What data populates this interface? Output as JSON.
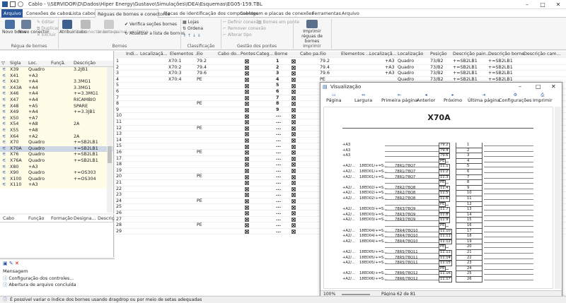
{
  "window": {
    "title": "Cablo - \\\\SERVIDOR\\D\\Dados\\Hiper Energy\\Gustavo\\Simulações\\IDEA\\Esquemas\\EG05-159.TBL"
  },
  "tabs": [
    "Arquivo",
    "Conexões de cabos",
    "Lista cabos",
    "Réguas de bornes e conectores",
    "Placas de identificação dos componentes",
    "Cablagem e placas de conexões",
    "Ferramentas",
    "Arquivo"
  ],
  "ribbon": {
    "novo_borne": "Novo borne",
    "novo_conector": "Novo conector",
    "editar": "Editar",
    "duplicar": "Duplicar",
    "excluir": "Excluir",
    "atribuir_cabo": "Atribuir cabo",
    "desconectar_bornes": "Desconectar bornes",
    "inverte_painel": "Inverte painel ↔externo",
    "verifica": "Verifica seções bornes",
    "atualizar": "Atualizar a lista de bornes",
    "lojas": "Lojas",
    "ordena": "Ordena",
    "definir": "Definir conexão",
    "remover": "Remover conexão",
    "alterar": "Alterar tipo",
    "bornes_ponte": "Bornes em ponte",
    "imprimir": "Imprimir réguas de bornes",
    "grp_reguas": "Régua de bornes",
    "grp_bornes": "Bornes",
    "grp_class": "Classificação",
    "grp_pontes": "Gestão dos pontes",
    "grp_imprimir": "Imprimir"
  },
  "left": {
    "headers": [
      "Sigla",
      "Loc.",
      "Funçã.",
      "Descrição"
    ],
    "rows": [
      [
        "X39",
        "Quadro",
        "",
        "3.2JB1"
      ],
      [
        "X41",
        "+A3",
        "",
        ""
      ],
      [
        "X43",
        "+A4",
        "",
        "3.3MG1"
      ],
      [
        "X43A",
        "+A4",
        "",
        "3.3MG1"
      ],
      [
        "X46",
        "+A4",
        "",
        "+=3.3MG1"
      ],
      [
        "X47",
        "+A4",
        "",
        "RICAMBIO"
      ],
      [
        "X48",
        "+A5",
        "",
        "SPARE"
      ],
      [
        "X49",
        "+A4",
        "",
        "+=3.3JB1"
      ],
      [
        "X50",
        "+A7",
        "",
        ""
      ],
      [
        "X54",
        "+A8",
        "",
        "2A"
      ],
      [
        "X55",
        "+A8",
        "",
        ""
      ],
      [
        "X64",
        "+A2",
        "",
        "2A"
      ],
      [
        "X70",
        "Quadro",
        "",
        "+=SB2LB1"
      ],
      [
        "X70A",
        "Quadro",
        "",
        "+=SB2LB1"
      ],
      [
        "X76",
        "Quadro",
        "",
        "+=SB2LB1"
      ],
      [
        "X76A",
        "Quadro",
        "",
        "+=SB2LB1"
      ],
      [
        "X80",
        "+A3",
        "",
        ""
      ],
      [
        "X90",
        "Quadro",
        "",
        "+=OS303"
      ],
      [
        "X100",
        "Quadro",
        "",
        "+=OS304"
      ],
      [
        "X110",
        "+A3",
        "",
        ""
      ]
    ],
    "bottom_headers": [
      "Cabo",
      "Função",
      "Formação",
      "Designa...",
      "Descrição"
    ]
  },
  "messages": {
    "header": "Mensagem",
    "items": [
      "Configuração dos controles...",
      "Abertura de arquivo concluída"
    ]
  },
  "status": "É possível variar o índice dos bornes usando dragdrop ou por meio de setas adequadas",
  "grid": {
    "headers": [
      "Indi...",
      "Localizaçã...",
      "Elementos ...",
      "Fio",
      "Cabo do...",
      "Pontes",
      "Categ...",
      "Borne",
      "Cabo pa...",
      "Fio",
      "Elementos ...",
      "Localizaçã...",
      "Localização",
      "Posição",
      "Descrição pain...",
      "Descrição borne",
      "Descrição cam..."
    ],
    "rows": [
      {
        "i": "1",
        "el": "X70:1",
        "fio": "79.2",
        "b": "1",
        "fio2": "79.2",
        "loc": "+A3",
        "loc2": "Quadro",
        "pos": "73/B2",
        "d1": "+=SB2LB1",
        "d2": "+=SB2LB1"
      },
      {
        "i": "2",
        "el": "X70:2",
        "fio": "79.4",
        "b": "2",
        "fio2": "79.4",
        "loc": "+A3",
        "loc2": "Quadro",
        "pos": "73/B2",
        "d1": "+=SB2LB1",
        "d2": "+=SB2LB1"
      },
      {
        "i": "3",
        "el": "X70:3",
        "fio": "79.6",
        "b": "3",
        "fio2": "79.6",
        "loc": "+A3",
        "loc2": "Quadro",
        "pos": "73/B2",
        "d1": "+=SB2LB1",
        "d2": "+=SB2LB1"
      },
      {
        "i": "4",
        "el": "X70:4",
        "fio": "PE",
        "b": "4",
        "fio2": "PE",
        "loc": "",
        "loc2": "Quadro",
        "pos": "73/B2",
        "d1": "+=SB2LB1",
        "d2": "+=SB2LB1"
      },
      {
        "i": "5",
        "el": "",
        "fio": "",
        "b": "5",
        "fio2": "",
        "loc": "",
        "loc2": "",
        "pos": "",
        "d1": "",
        "d2": ""
      },
      {
        "i": "6",
        "el": "",
        "fio": "",
        "b": "6",
        "fio2": "",
        "loc": "",
        "loc2": "",
        "pos": "",
        "d1": "",
        "d2": ""
      },
      {
        "i": "7",
        "el": "",
        "fio": "",
        "b": "7",
        "fio2": "",
        "loc": "",
        "loc2": "",
        "pos": "",
        "d1": "",
        "d2": ""
      },
      {
        "i": "8",
        "el": "",
        "fio": "PE",
        "b": "8",
        "fio2": "",
        "loc": "",
        "loc2": "",
        "pos": "",
        "d1": "",
        "d2": ""
      },
      {
        "i": "9",
        "el": "",
        "fio": "",
        "b": "9",
        "fio2": "",
        "loc": "",
        "loc2": "",
        "pos": "",
        "d1": "",
        "d2": ""
      },
      {
        "i": "10",
        "el": "",
        "fio": "",
        "b": "...",
        "fio2": "",
        "loc": "",
        "loc2": "",
        "pos": "",
        "d1": "",
        "d2": ""
      },
      {
        "i": "11",
        "el": "",
        "fio": "",
        "b": "...",
        "fio2": "",
        "loc": "",
        "loc2": "",
        "pos": "",
        "d1": "",
        "d2": ""
      },
      {
        "i": "12",
        "el": "",
        "fio": "PE",
        "b": "...",
        "fio2": "",
        "loc": "",
        "loc2": "",
        "pos": "",
        "d1": "",
        "d2": ""
      },
      {
        "i": "13",
        "el": "",
        "fio": "",
        "b": "...",
        "fio2": "",
        "loc": "",
        "loc2": "",
        "pos": "",
        "d1": "",
        "d2": ""
      },
      {
        "i": "14",
        "el": "",
        "fio": "",
        "b": "...",
        "fio2": "",
        "loc": "",
        "loc2": "",
        "pos": "",
        "d1": "",
        "d2": ""
      },
      {
        "i": "15",
        "el": "",
        "fio": "",
        "b": "...",
        "fio2": "",
        "loc": "",
        "loc2": "",
        "pos": "",
        "d1": "",
        "d2": ""
      },
      {
        "i": "16",
        "el": "",
        "fio": "PE",
        "b": "...",
        "fio2": "",
        "loc": "",
        "loc2": "",
        "pos": "",
        "d1": "",
        "d2": ""
      },
      {
        "i": "17",
        "el": "",
        "fio": "",
        "b": "...",
        "fio2": "",
        "loc": "",
        "loc2": "",
        "pos": "",
        "d1": "",
        "d2": ""
      },
      {
        "i": "18",
        "el": "",
        "fio": "",
        "b": "...",
        "fio2": "",
        "loc": "",
        "loc2": "",
        "pos": "",
        "d1": "",
        "d2": ""
      },
      {
        "i": "19",
        "el": "",
        "fio": "",
        "b": "...",
        "fio2": "",
        "loc": "",
        "loc2": "",
        "pos": "",
        "d1": "",
        "d2": ""
      },
      {
        "i": "20",
        "el": "",
        "fio": "PE",
        "b": "...",
        "fio2": "",
        "loc": "",
        "loc2": "",
        "pos": "",
        "d1": "",
        "d2": ""
      },
      {
        "i": "21",
        "el": "",
        "fio": "",
        "b": "...",
        "fio2": "",
        "loc": "",
        "loc2": "",
        "pos": "",
        "d1": "",
        "d2": ""
      },
      {
        "i": "22",
        "el": "",
        "fio": "",
        "b": "...",
        "fio2": "",
        "loc": "",
        "loc2": "",
        "pos": "",
        "d1": "",
        "d2": ""
      },
      {
        "i": "23",
        "el": "",
        "fio": "",
        "b": "...",
        "fio2": "",
        "loc": "",
        "loc2": "",
        "pos": "",
        "d1": "",
        "d2": ""
      },
      {
        "i": "24",
        "el": "",
        "fio": "PE",
        "b": "...",
        "fio2": "",
        "loc": "",
        "loc2": "",
        "pos": "",
        "d1": "",
        "d2": ""
      },
      {
        "i": "25",
        "el": "",
        "fio": "",
        "b": "...",
        "fio2": "",
        "loc": "",
        "loc2": "",
        "pos": "",
        "d1": "",
        "d2": ""
      },
      {
        "i": "26",
        "el": "",
        "fio": "",
        "b": "...",
        "fio2": "",
        "loc": "",
        "loc2": "",
        "pos": "",
        "d1": "",
        "d2": ""
      },
      {
        "i": "27",
        "el": "",
        "fio": "",
        "b": "...",
        "fio2": "",
        "loc": "",
        "loc2": "",
        "pos": "",
        "d1": "",
        "d2": ""
      },
      {
        "i": "28",
        "el": "",
        "fio": "PE",
        "b": "...",
        "fio2": "",
        "loc": "",
        "loc2": "",
        "pos": "",
        "d1": "",
        "d2": ""
      },
      {
        "i": "29",
        "el": "",
        "fio": "",
        "b": "...",
        "fio2": "",
        "loc": "",
        "loc2": "",
        "pos": "",
        "d1": "",
        "d2": ""
      }
    ]
  },
  "preview": {
    "title": "Visualização",
    "buttons": [
      "Página",
      "Largura",
      "Primeira página",
      "Anterior",
      "Próximo",
      "Última página",
      "Configurações",
      "Imprimir"
    ],
    "sheet_title": "X70A",
    "rows": [
      {
        "a": "+A3",
        "m": "",
        "w": "79.2",
        "n": "1"
      },
      {
        "a": "+A3",
        "m": "",
        "w": "79.4",
        "n": "2"
      },
      {
        "a": "+A3",
        "m": "",
        "w": "79.6",
        "n": "3"
      },
      {
        "a": "",
        "m": "",
        "w": "PE",
        "n": "4"
      },
      {
        "a": "+A2/...",
        "m": "18ED01/+=S...",
        "c": "78R1/78Q7",
        "w": "11.1",
        "n": "5"
      },
      {
        "a": "+A2/...",
        "m": "18ED01/+=S...",
        "c": "78R1/78Q7",
        "w": "11.2",
        "n": "6"
      },
      {
        "a": "+A2/...",
        "m": "18ED01/+=S...",
        "c": "78R1/78Q7",
        "w": "11.3",
        "n": "7"
      },
      {
        "a": "",
        "m": "",
        "w": "PE",
        "n": "8"
      },
      {
        "a": "+A2/...",
        "m": "18ED02/+=S...",
        "c": "78R2/78Q8",
        "w": "11.4",
        "n": "9"
      },
      {
        "a": "+A2/...",
        "m": "18ED02/+=S...",
        "c": "78R2/78Q8",
        "w": "11.5",
        "n": "10"
      },
      {
        "a": "+A2/...",
        "m": "18ED02/+=S...",
        "c": "78R2/78Q8",
        "w": "11.6",
        "n": "11"
      },
      {
        "a": "",
        "m": "",
        "w": "PE",
        "n": "12"
      },
      {
        "a": "+A2/...",
        "m": "18ED03/+=S...",
        "c": "78R3/78Q9",
        "w": "11.7",
        "n": "13"
      },
      {
        "a": "+A2/...",
        "m": "18ED03/+=S...",
        "c": "78R3/78Q9",
        "w": "11.8",
        "n": "14"
      },
      {
        "a": "+A2/...",
        "m": "18ED03/+=S...",
        "c": "78R3/78Q9",
        "w": "11.9",
        "n": "15"
      },
      {
        "a": "",
        "m": "",
        "w": "PE",
        "n": "16"
      },
      {
        "a": "+A2/...",
        "m": "18ED04/+=S...",
        "c": "78R4/78Q10",
        "w": "11.10",
        "n": "17"
      },
      {
        "a": "+A2/...",
        "m": "18ED04/+=S...",
        "c": "78R4/78Q10",
        "w": "11.11",
        "n": "18"
      },
      {
        "a": "+A2/...",
        "m": "18ED04/+=S...",
        "c": "78R4/78Q10",
        "w": "11.12",
        "n": "19"
      },
      {
        "a": "",
        "m": "",
        "w": "PE",
        "n": "20"
      },
      {
        "a": "+A2/...",
        "m": "18ED05/+=S...",
        "c": "78R5/78Q11",
        "w": "11.13",
        "n": "21"
      },
      {
        "a": "+A2/...",
        "m": "18ED05/+=S...",
        "c": "78R5/78Q11",
        "w": "11.14",
        "n": "22"
      },
      {
        "a": "+A2/...",
        "m": "18ED05/+=S...",
        "c": "78R5/78Q11",
        "w": "11.15",
        "n": "23"
      },
      {
        "a": "",
        "m": "",
        "w": "PE",
        "n": "24"
      },
      {
        "a": "+A2/...",
        "m": "18ED06/+=S...",
        "c": "78R6/78Q12",
        "w": "11.16",
        "n": "25"
      },
      {
        "a": "+A2/...",
        "m": "18ED06/+=S...",
        "c": "78R6/78Q12",
        "w": "11.17",
        "n": "26"
      }
    ],
    "zoom": "100%",
    "page": "Página 62 de 81"
  }
}
